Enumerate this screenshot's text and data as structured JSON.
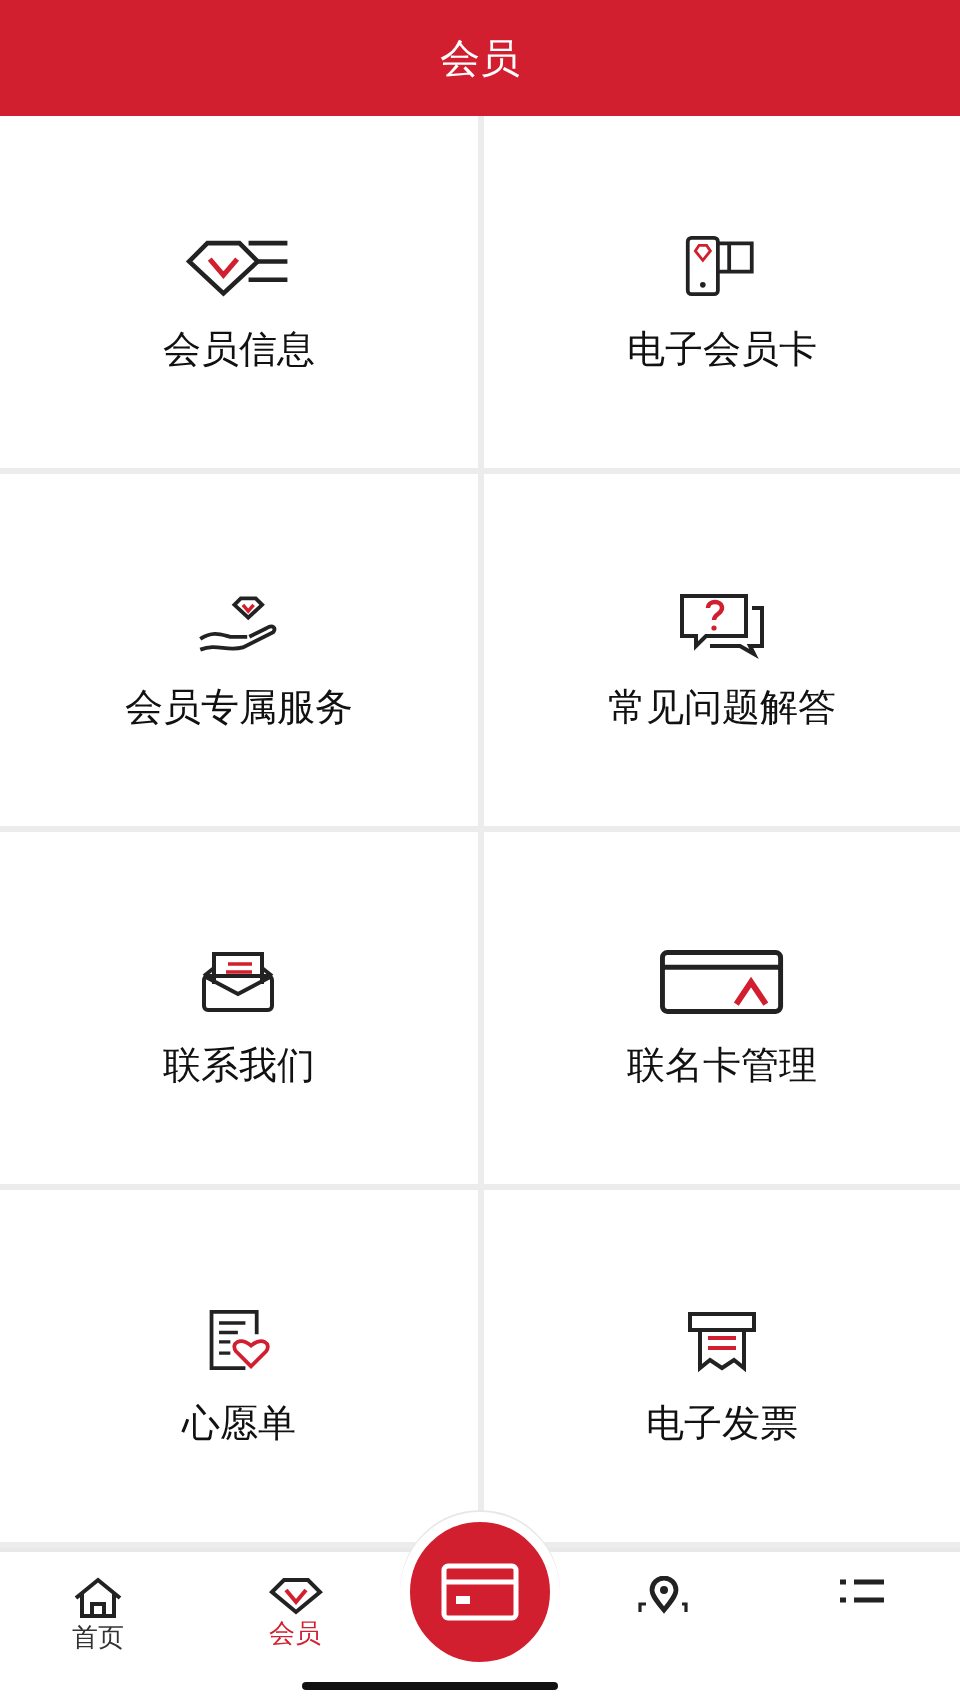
{
  "header": {
    "title": "会员"
  },
  "menu": [
    {
      "label": "会员信息"
    },
    {
      "label": "电子会员卡"
    },
    {
      "label": "会员专属服务"
    },
    {
      "label": "常见问题解答"
    },
    {
      "label": "联系我们"
    },
    {
      "label": "联名卡管理"
    },
    {
      "label": "心愿单"
    },
    {
      "label": "电子发票"
    }
  ],
  "tabbar": [
    {
      "kind": "tab",
      "label": "首页",
      "selected": false
    },
    {
      "kind": "tab",
      "label": "会员",
      "selected": true
    },
    {
      "kind": "center"
    },
    {
      "kind": "tab",
      "selected": false
    },
    {
      "kind": "tab",
      "selected": false
    }
  ]
}
